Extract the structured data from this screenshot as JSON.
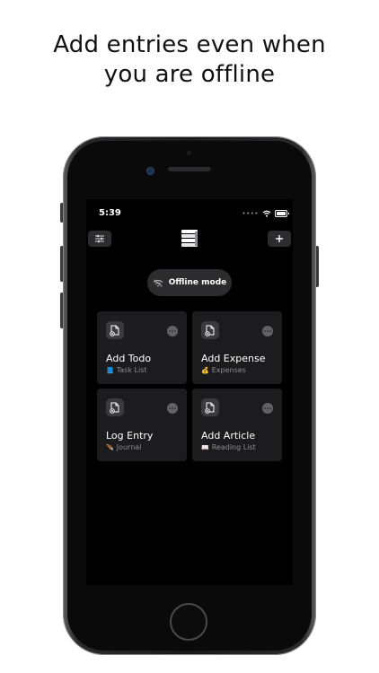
{
  "headline": {
    "line1": "Add entries even when",
    "line2": "you are offline"
  },
  "status_bar": {
    "time": "5:39",
    "icons": [
      "signal-dots-icon",
      "wifi-icon",
      "battery-icon"
    ]
  },
  "header": {
    "left_icon": "sliders-icon",
    "logo_icon": "stack-logo-icon",
    "right_icon": "plus-icon"
  },
  "offline_pill": {
    "icon": "wifi-off-icon",
    "label": "Offline mode"
  },
  "cards": [
    {
      "title": "Add Todo",
      "emoji": "📘",
      "subtitle": "Task List",
      "icon": "add-document-icon"
    },
    {
      "title": "Add Expense",
      "emoji": "💰",
      "subtitle": "Expenses",
      "icon": "add-document-icon"
    },
    {
      "title": "Log Entry",
      "emoji": "🪶",
      "subtitle": "Journal",
      "icon": "add-document-icon"
    },
    {
      "title": "Add Article",
      "emoji": "📖",
      "subtitle": "Reading List",
      "icon": "add-document-icon"
    }
  ],
  "colors": {
    "screen_bg": "#000000",
    "card_bg": "#1c1c1e",
    "pill_bg": "#2c2c2e",
    "secondary_text": "#8e8e93"
  }
}
